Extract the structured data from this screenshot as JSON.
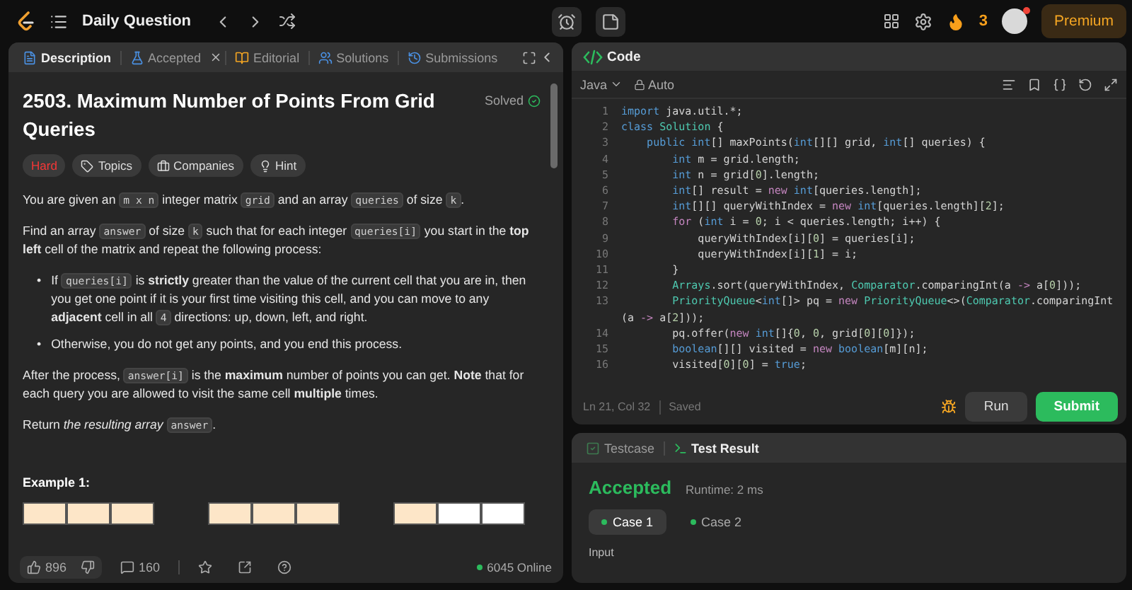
{
  "topbar": {
    "title": "Daily Question",
    "streak": "3",
    "premium": "Premium"
  },
  "left_tabs": [
    {
      "label": "Description",
      "kind": "description",
      "selected": true,
      "closable": false
    },
    {
      "label": "Accepted",
      "kind": "accepted",
      "selected": false,
      "closable": true
    },
    {
      "label": "Editorial",
      "kind": "editorial",
      "selected": false,
      "closable": false
    },
    {
      "label": "Solutions",
      "kind": "solutions",
      "selected": false,
      "closable": false
    },
    {
      "label": "Submissions",
      "kind": "submissions",
      "selected": false,
      "closable": false
    }
  ],
  "problem": {
    "title": "2503. Maximum Number of Points From Grid Queries",
    "status": "Solved",
    "tags": [
      {
        "label": "Hard",
        "kind": "difficulty"
      },
      {
        "label": "Topics",
        "kind": "topics"
      },
      {
        "label": "Companies",
        "kind": "companies"
      },
      {
        "label": "Hint",
        "kind": "hint"
      }
    ],
    "body": [
      {
        "kind": "paragraph",
        "parts": [
          {
            "kind": "text",
            "text": "You are given an "
          },
          {
            "kind": "code",
            "text": "m x n"
          },
          {
            "kind": "text",
            "text": " integer matrix "
          },
          {
            "kind": "code",
            "text": "grid"
          },
          {
            "kind": "text",
            "text": " and an array "
          },
          {
            "kind": "code",
            "text": "queries"
          },
          {
            "kind": "text",
            "text": " of size "
          },
          {
            "kind": "code",
            "text": "k"
          },
          {
            "kind": "text",
            "text": "."
          }
        ]
      },
      {
        "kind": "paragraph",
        "parts": [
          {
            "kind": "text",
            "text": "Find an array "
          },
          {
            "kind": "code",
            "text": "answer"
          },
          {
            "kind": "text",
            "text": " of size "
          },
          {
            "kind": "code",
            "text": "k"
          },
          {
            "kind": "text",
            "text": " such that for each integer "
          },
          {
            "kind": "code",
            "text": "queries[i]"
          },
          {
            "kind": "text",
            "text": " you start in the **top left** cell of the matrix and repeat the following process:"
          }
        ]
      },
      {
        "kind": "bullets",
        "marker": "•",
        "items": [
          [
            {
              "kind": "text",
              "text": "If "
            },
            {
              "kind": "code",
              "text": "queries[i]"
            },
            {
              "kind": "text",
              "text": " is **strictly** greater than the value of the current cell that you are in, then you get one point if it is your first time visiting this cell, and you can move to any **adjacent** cell in all "
            },
            {
              "kind": "code",
              "text": "4"
            },
            {
              "kind": "text",
              "text": " directions: up, down, left, and right."
            }
          ],
          [
            {
              "kind": "text",
              "text": "Otherwise, you do not get any points, and you end this process."
            }
          ]
        ]
      },
      {
        "kind": "paragraph",
        "parts": [
          {
            "kind": "text",
            "text": "After the process, "
          },
          {
            "kind": "code",
            "text": "answer[i]"
          },
          {
            "kind": "text",
            "text": " is the **maximum** number of points you can get. **Note** that for each query you are allowed to visit the same cell **multiple** times."
          }
        ]
      },
      {
        "kind": "paragraph",
        "parts": [
          {
            "kind": "text",
            "text": "Return *the resulting array* "
          },
          {
            "kind": "code",
            "text": "answer"
          },
          {
            "kind": "text",
            "text": "."
          }
        ]
      }
    ],
    "example_title": "Example 1:"
  },
  "left_footer": {
    "likes": "896",
    "comments": "160",
    "online": "6045 Online"
  },
  "code_panel": {
    "title": "Code",
    "language": "Java",
    "mode": "Auto",
    "position": "Ln 21, Col 32",
    "save_state": "Saved",
    "run": "Run",
    "submit": "Submit",
    "lines": [
      {
        "num": "1",
        "tokens": [
          {
            "kind": "kw",
            "text": "import"
          },
          {
            "kind": "p",
            "text": " java.util.*;"
          }
        ]
      },
      {
        "num": "2",
        "tokens": [
          {
            "kind": "kw",
            "text": "class"
          },
          {
            "kind": "ty",
            "text": " Solution"
          },
          {
            "kind": "p",
            "text": " {"
          }
        ]
      },
      {
        "num": "3",
        "tokens": [
          {
            "kind": "kw",
            "text": "    public int"
          },
          {
            "kind": "p",
            "text": "[] maxPoints("
          },
          {
            "kind": "kw",
            "text": "int"
          },
          {
            "kind": "p",
            "text": "[][] grid, "
          },
          {
            "kind": "kw",
            "text": "int"
          },
          {
            "kind": "p",
            "text": "[] queries) {"
          }
        ]
      },
      {
        "num": "4",
        "tokens": [
          {
            "kind": "kw",
            "text": "        int"
          },
          {
            "kind": "p",
            "text": " m = grid.length;"
          }
        ]
      },
      {
        "num": "5",
        "tokens": [
          {
            "kind": "kw",
            "text": "        int"
          },
          {
            "kind": "p",
            "text": " n = grid["
          },
          {
            "kind": "nu",
            "text": "0"
          },
          {
            "kind": "p",
            "text": "].length;"
          }
        ]
      },
      {
        "num": "6",
        "tokens": [
          {
            "kind": "kw",
            "text": "        int"
          },
          {
            "kind": "p",
            "text": "[] result = "
          },
          {
            "kind": "op",
            "text": "new"
          },
          {
            "kind": "kw",
            "text": " int"
          },
          {
            "kind": "p",
            "text": "[queries.length];"
          }
        ]
      },
      {
        "num": "7",
        "tokens": [
          {
            "kind": "kw",
            "text": "        int"
          },
          {
            "kind": "p",
            "text": "[][] queryWithIndex = "
          },
          {
            "kind": "op",
            "text": "new"
          },
          {
            "kind": "kw",
            "text": " int"
          },
          {
            "kind": "p",
            "text": "[queries.length]["
          },
          {
            "kind": "nu",
            "text": "2"
          },
          {
            "kind": "p",
            "text": "];"
          }
        ]
      },
      {
        "num": "8",
        "tokens": [
          {
            "kind": "op",
            "text": "        for"
          },
          {
            "kind": "p",
            "text": " ("
          },
          {
            "kind": "kw",
            "text": "int"
          },
          {
            "kind": "p",
            "text": " i = "
          },
          {
            "kind": "nu",
            "text": "0"
          },
          {
            "kind": "p",
            "text": "; i < queries.length; i++) {"
          }
        ]
      },
      {
        "num": "9",
        "tokens": [
          {
            "kind": "p",
            "text": "            queryWithIndex[i]["
          },
          {
            "kind": "nu",
            "text": "0"
          },
          {
            "kind": "p",
            "text": "] = queries[i];"
          }
        ]
      },
      {
        "num": "10",
        "tokens": [
          {
            "kind": "p",
            "text": "            queryWithIndex[i]["
          },
          {
            "kind": "nu",
            "text": "1"
          },
          {
            "kind": "p",
            "text": "] = i;"
          }
        ]
      },
      {
        "num": "11",
        "tokens": [
          {
            "kind": "p",
            "text": "        }"
          }
        ]
      },
      {
        "num": "12",
        "tokens": [
          {
            "kind": "ty",
            "text": "        Arrays"
          },
          {
            "kind": "p",
            "text": ".sort(queryWithIndex, "
          },
          {
            "kind": "ty",
            "text": "Comparator"
          },
          {
            "kind": "p",
            "text": ".comparingInt(a "
          },
          {
            "kind": "op",
            "text": "->"
          },
          {
            "kind": "p",
            "text": " a["
          },
          {
            "kind": "nu",
            "text": "0"
          },
          {
            "kind": "p",
            "text": "]));"
          }
        ]
      },
      {
        "num": "13",
        "tokens": [
          {
            "kind": "ty",
            "text": "        PriorityQueue"
          },
          {
            "kind": "p",
            "text": "<"
          },
          {
            "kind": "kw",
            "text": "int"
          },
          {
            "kind": "p",
            "text": "[]> pq = "
          },
          {
            "kind": "op",
            "text": "new"
          },
          {
            "kind": "ty",
            "text": " PriorityQueue"
          },
          {
            "kind": "p",
            "text": "<>("
          },
          {
            "kind": "ty",
            "text": "Comparator"
          },
          {
            "kind": "p",
            "text": ".comparingInt"
          }
        ]
      },
      {
        "tokens": [
          {
            "kind": "p",
            "text": "(a "
          },
          {
            "kind": "op",
            "text": "->"
          },
          {
            "kind": "p",
            "text": " a["
          },
          {
            "kind": "nu",
            "text": "2"
          },
          {
            "kind": "p",
            "text": "]));"
          }
        ]
      },
      {
        "num": "14",
        "tokens": [
          {
            "kind": "p",
            "text": "        pq.offer("
          },
          {
            "kind": "op",
            "text": "new"
          },
          {
            "kind": "kw",
            "text": " int"
          },
          {
            "kind": "p",
            "text": "[]{"
          },
          {
            "kind": "nu",
            "text": "0"
          },
          {
            "kind": "p",
            "text": ", "
          },
          {
            "kind": "nu",
            "text": "0"
          },
          {
            "kind": "p",
            "text": ", grid["
          },
          {
            "kind": "nu",
            "text": "0"
          },
          {
            "kind": "p",
            "text": "]["
          },
          {
            "kind": "nu",
            "text": "0"
          },
          {
            "kind": "p",
            "text": "]});"
          }
        ]
      },
      {
        "num": "15",
        "tokens": [
          {
            "kind": "kw",
            "text": "        boolean"
          },
          {
            "kind": "p",
            "text": "[][] visited = "
          },
          {
            "kind": "op",
            "text": "new"
          },
          {
            "kind": "kw",
            "text": " boolean"
          },
          {
            "kind": "p",
            "text": "[m][n];"
          }
        ]
      },
      {
        "num": "16",
        "tokens": [
          {
            "kind": "p",
            "text": "        visited["
          },
          {
            "kind": "nu",
            "text": "0"
          },
          {
            "kind": "p",
            "text": "]["
          },
          {
            "kind": "nu",
            "text": "0"
          },
          {
            "kind": "p",
            "text": "] = "
          },
          {
            "kind": "kw",
            "text": "true"
          },
          {
            "kind": "p",
            "text": ";"
          }
        ]
      }
    ]
  },
  "test_tabs": [
    {
      "label": "Testcase",
      "kind": "testcase",
      "selected": false
    },
    {
      "label": "Test Result",
      "kind": "result",
      "selected": true
    }
  ],
  "result": {
    "verdict": "Accepted",
    "runtime": "Runtime: 2 ms",
    "cases": [
      {
        "label": "Case 1",
        "selected": true
      },
      {
        "label": "Case 2",
        "selected": false
      }
    ],
    "input_label": "Input"
  }
}
